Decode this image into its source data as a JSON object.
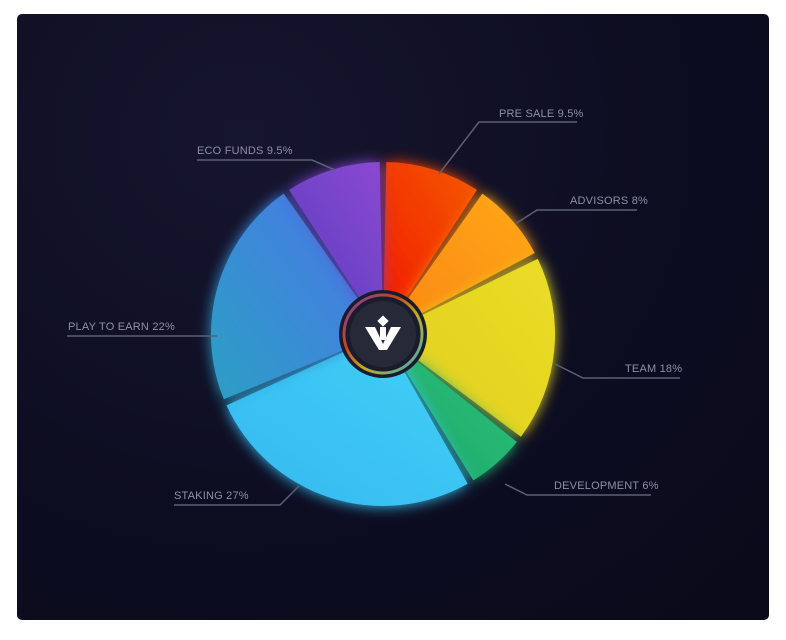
{
  "chart_data": {
    "type": "pie",
    "title": "",
    "slices": [
      {
        "label": "PRE SALE 9.5%",
        "name": "Pre Sale",
        "value": 9.5,
        "color": "#f45a00",
        "color2": "#f21e00"
      },
      {
        "label": "ADVISORS 8%",
        "name": "Advisors",
        "value": 8,
        "color": "#ffa81a",
        "color2": "#fb8a10"
      },
      {
        "label": "TEAM 18%",
        "name": "Team",
        "value": 18,
        "color": "#eadd26",
        "color2": "#e2cf20"
      },
      {
        "label": "DEVELOPMENT 6%",
        "name": "Development",
        "value": 6,
        "color": "#2bc079",
        "color2": "#1fa86a"
      },
      {
        "label": "STAKING 27%",
        "name": "Staking",
        "value": 27,
        "color": "#3fd0f7",
        "color2": "#37b8ef"
      },
      {
        "label": "PLAY TO EARN 22%",
        "name": "Play to Earn",
        "value": 22,
        "color": "#4a76e8",
        "color2": "#2b9fc4"
      },
      {
        "label": "ECO FUNDS 9.5%",
        "name": "Eco Funds",
        "value": 9.5,
        "color": "#8b48d0",
        "color2": "#5b3fc0"
      }
    ],
    "legend": "callout-labels"
  }
}
